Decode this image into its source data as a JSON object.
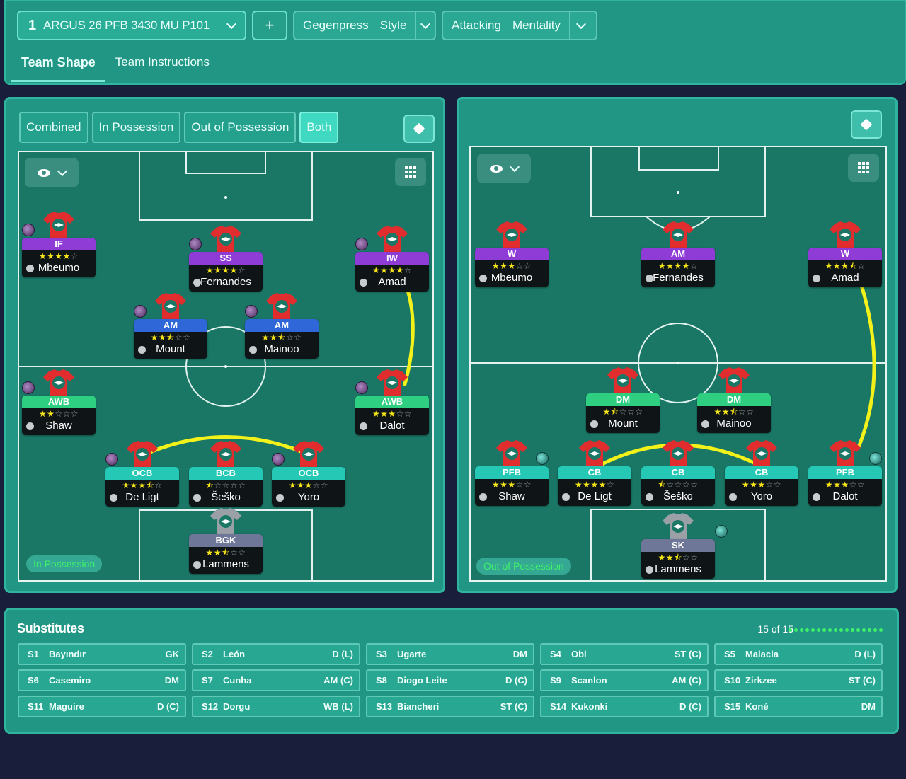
{
  "header": {
    "tactic_number": "1",
    "tactic_name": "ARGUS 26 PFB 3430 MU P101",
    "add_label": "+",
    "style": [
      "Gegenpress",
      "Style"
    ],
    "mentality": [
      "Attacking",
      "Mentality"
    ],
    "tabs": [
      "Team Shape",
      "Team Instructions"
    ]
  },
  "left_panel": {
    "modes": [
      "Combined",
      "In Possession",
      "Out of Possession",
      "Both"
    ],
    "phase_label": "In Possession",
    "players": [
      {
        "role": "IF",
        "stars": "★★★★☆",
        "name": "Mbeumo"
      },
      {
        "role": "SS",
        "stars": "★★★★☆",
        "name": "Fernandes"
      },
      {
        "role": "IW",
        "stars": "★★★★☆",
        "name": "Amad"
      },
      {
        "role": "AM",
        "stars": "★★⯪☆☆",
        "name": "Mount"
      },
      {
        "role": "AM",
        "stars": "★★⯪☆☆",
        "name": "Mainoo"
      },
      {
        "role": "AWB",
        "stars": "★★☆☆☆",
        "name": "Shaw"
      },
      {
        "role": "AWB",
        "stars": "★★★☆☆",
        "name": "Dalot"
      },
      {
        "role": "OCB",
        "stars": "★★★⯪☆",
        "name": "De Ligt"
      },
      {
        "role": "BCB",
        "stars": "⯪☆☆☆☆",
        "name": "Šeško"
      },
      {
        "role": "OCB",
        "stars": "★★★☆☆",
        "name": "Yoro"
      },
      {
        "role": "BGK",
        "stars": "★★⯪☆☆",
        "name": "Lammens"
      }
    ]
  },
  "right_panel": {
    "phase_label": "Out of Possession",
    "players": [
      {
        "role": "W",
        "stars": "★★★☆☆",
        "name": "Mbeumo"
      },
      {
        "role": "AM",
        "stars": "★★★★☆",
        "name": "Fernandes"
      },
      {
        "role": "W",
        "stars": "★★★⯪☆",
        "name": "Amad"
      },
      {
        "role": "DM",
        "stars": "★⯪☆☆☆",
        "name": "Mount"
      },
      {
        "role": "DM",
        "stars": "★★⯪☆☆",
        "name": "Mainoo"
      },
      {
        "role": "PFB",
        "stars": "★★★☆☆",
        "name": "Shaw"
      },
      {
        "role": "CB",
        "stars": "★★★★☆",
        "name": "De Ligt"
      },
      {
        "role": "CB",
        "stars": "⯪☆☆☆☆",
        "name": "Šeško"
      },
      {
        "role": "CB",
        "stars": "★★★☆☆",
        "name": "Yoro"
      },
      {
        "role": "PFB",
        "stars": "★★★☆☆",
        "name": "Dalot"
      },
      {
        "role": "SK",
        "stars": "★★⯪☆☆",
        "name": "Lammens"
      }
    ]
  },
  "substitutes": {
    "title": "Substitutes",
    "count": "15 of 15",
    "items": [
      {
        "slot": "S1",
        "name": "Bayındır",
        "pos": "GK"
      },
      {
        "slot": "S2",
        "name": "León",
        "pos": "D (L)"
      },
      {
        "slot": "S3",
        "name": "Ugarte",
        "pos": "DM"
      },
      {
        "slot": "S4",
        "name": "Obi",
        "pos": "ST (C)"
      },
      {
        "slot": "S5",
        "name": "Malacia",
        "pos": "D (L)"
      },
      {
        "slot": "S6",
        "name": "Casemiro",
        "pos": "DM"
      },
      {
        "slot": "S7",
        "name": "Cunha",
        "pos": "AM (C)"
      },
      {
        "slot": "S8",
        "name": "Diogo Leite",
        "pos": "D (C)"
      },
      {
        "slot": "S9",
        "name": "Scanlon",
        "pos": "AM (C)"
      },
      {
        "slot": "S10",
        "name": "Zirkzee",
        "pos": "ST (C)"
      },
      {
        "slot": "S11",
        "name": "Maguire",
        "pos": "D (C)"
      },
      {
        "slot": "S12",
        "name": "Dorgu",
        "pos": "WB (L)"
      },
      {
        "slot": "S13",
        "name": "Biancheri",
        "pos": "ST (C)"
      },
      {
        "slot": "S14",
        "name": "Kukonki",
        "pos": "D (C)"
      },
      {
        "slot": "S15",
        "name": "Koné",
        "pos": "DM"
      }
    ]
  },
  "colors": {
    "panel": "#229684",
    "pitch": "#1a7766",
    "background": "#191f3a",
    "link_line": "#f2f21a",
    "star_on": "#f5e41a",
    "role_attack": "#8f3bd6",
    "role_am": "#2f67d8",
    "role_wingback": "#2ecf80",
    "role_def": "#25c8b5",
    "role_gk": "#6f7798"
  },
  "icons": [
    "chevron-down-icon",
    "plus-icon",
    "diamond-icon",
    "eye-icon",
    "grid-icon",
    "shirt-icon",
    "person-icon",
    "trait-badge-icon"
  ]
}
